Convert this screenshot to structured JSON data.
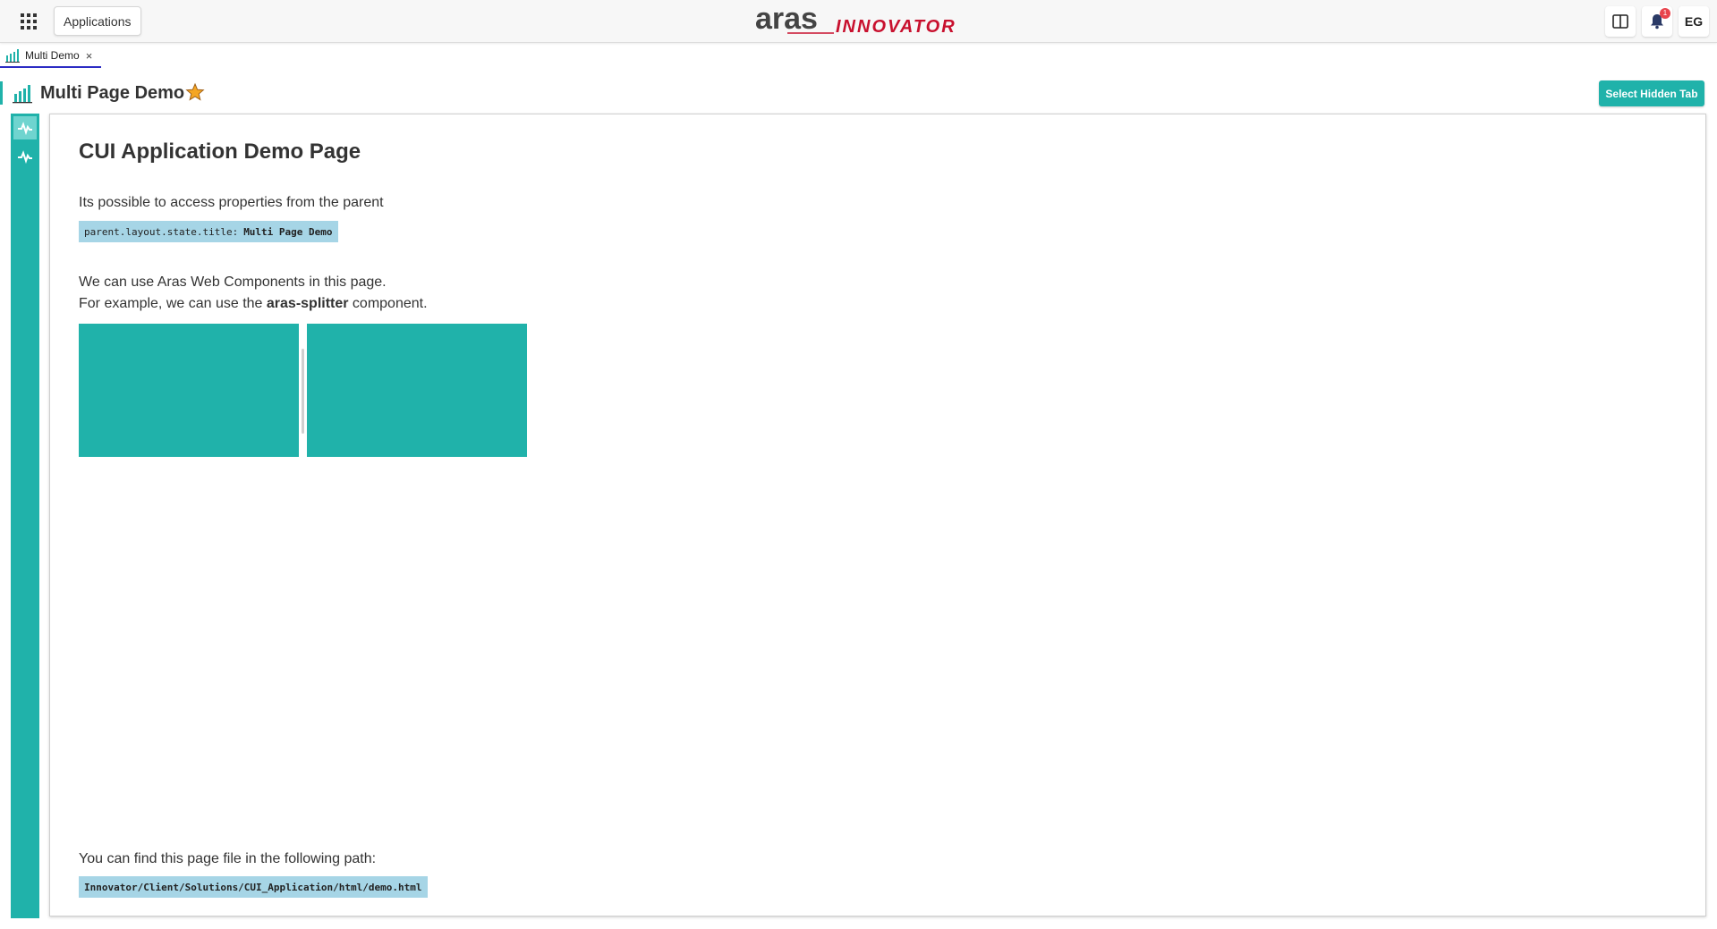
{
  "header": {
    "apps_label": "Applications",
    "logo_main": "aras",
    "logo_sub": "INNOVATOR",
    "notification_count": "1",
    "user_initials": "EG"
  },
  "tabs": [
    {
      "label": "Multi Demo",
      "close": "×"
    }
  ],
  "page": {
    "title": "Multi Page Demo",
    "select_hidden_tab": "Select Hidden Tab"
  },
  "sidebar": {
    "items": [
      {
        "icon": "activity-icon",
        "active": true
      },
      {
        "icon": "activity-icon",
        "active": false
      }
    ]
  },
  "content": {
    "heading": "CUI Application Demo Page",
    "parent_text": "Its possible to access properties from the parent",
    "parent_code_key": "parent.layout.state.title:",
    "parent_code_value": "Multi Page Demo",
    "wc_line1": "We can use Aras Web Components in this page.",
    "wc_line2_pre": "For example, we can use the ",
    "wc_line2_bold": "aras-splitter",
    "wc_line2_post": " component.",
    "path_text": "You can find this page file in the following path:",
    "path_code": "Innovator/Client/Solutions/CUI_Application/html/demo.html"
  },
  "colors": {
    "accent": "#20b2aa",
    "code_bg": "#a6d5e6",
    "tab_underline": "#2c2cc4",
    "logo_red": "#c8102e",
    "badge": "#e8444d",
    "star": "#f5a623"
  }
}
